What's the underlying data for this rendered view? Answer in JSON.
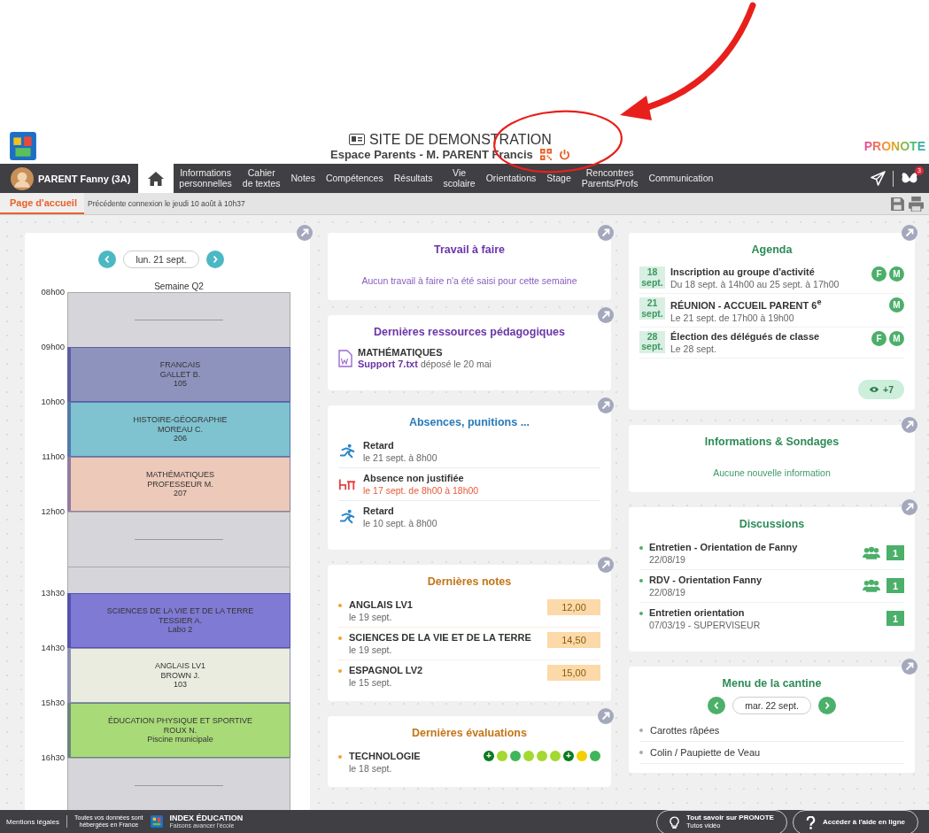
{
  "header": {
    "title": "SITE DE DEMONSTRATION",
    "subtitle": "Espace Parents - M. PARENT Francis",
    "brand": "PRONOTE"
  },
  "nav": {
    "user": "PARENT Fanny (3A)",
    "items": [
      {
        "kind": "home",
        "selected": true
      },
      {
        "kind": "text",
        "label": "Informations\npersonnelles",
        "selected": false
      },
      {
        "kind": "text",
        "label": "Cahier\nde textes",
        "selected": false
      },
      {
        "kind": "text",
        "label": "Notes",
        "selected": false
      },
      {
        "kind": "text",
        "label": "Compétences",
        "selected": false
      },
      {
        "kind": "text",
        "label": "Résultats",
        "selected": false
      },
      {
        "kind": "text",
        "label": "Vie\nscolaire",
        "selected": false
      },
      {
        "kind": "text",
        "label": "Orientations",
        "selected": false
      },
      {
        "kind": "text",
        "label": "Stage",
        "selected": false
      },
      {
        "kind": "text",
        "label": "Rencontres\nParents/Profs",
        "selected": false
      },
      {
        "kind": "text",
        "label": "Communication",
        "selected": false
      }
    ],
    "notification_badge": "3"
  },
  "subbar": {
    "tabs": [
      {
        "label": "Page d'accueil",
        "selected": true
      }
    ],
    "last_login": "Précédente connexion le jeudi 10 août à 10h37"
  },
  "timetable": {
    "date": "lun. 21 sept.",
    "week": "Semaine Q2",
    "slots": [
      {
        "time": "08h00",
        "kind": "free"
      },
      {
        "time": "09h00",
        "kind": "course",
        "color": "#8e93bd",
        "lines": [
          "FRANCAIS",
          "GALLET B.",
          "105"
        ]
      },
      {
        "time": "10h00",
        "kind": "course",
        "color": "#7fc2d0",
        "lines": [
          "HISTOIRE-GÉOGRAPHIE",
          "MOREAU C.",
          "206"
        ]
      },
      {
        "time": "11h00",
        "kind": "course",
        "color": "#ecc9b9",
        "lines": [
          "MATHÉMATIQUES",
          "PROFESSEUR M.",
          "207"
        ]
      },
      {
        "time": "12h00",
        "kind": "free"
      },
      {
        "kind": "break"
      },
      {
        "time": "13h30",
        "kind": "course",
        "color": "#7f7ad3",
        "lines": [
          "SCIENCES DE LA VIE ET DE LA TERRE",
          "TESSIER A.",
          "Labo 2"
        ]
      },
      {
        "time": "14h30",
        "kind": "course",
        "color": "#ebece0",
        "lines": [
          "ANGLAIS LV1",
          "BROWN J.",
          "103"
        ]
      },
      {
        "time": "15h30",
        "kind": "course",
        "color": "#a9da78",
        "lines": [
          "ÉDUCATION PHYSIQUE ET SPORTIVE",
          "ROUX N.",
          "Piscine municipale"
        ]
      },
      {
        "time": "16h30",
        "kind": "free"
      }
    ]
  },
  "homework": {
    "title": "Travail à faire",
    "message": "Aucun travail à faire n'a été saisi pour cette semaine"
  },
  "resources": {
    "title": "Dernières ressources pédagogiques",
    "items": [
      {
        "subject": "MATHÉMATIQUES",
        "file": "Support 7.txt",
        "note": "déposé le 20 mai"
      }
    ]
  },
  "absences": {
    "title": "Absences, punitions ...",
    "items": [
      {
        "kind": "late",
        "title": "Retard",
        "detail": "le 21 sept. à 8h00"
      },
      {
        "kind": "absence",
        "title": "Absence non justifiée",
        "detail": "le 17 sept. de 8h00 à 18h00"
      },
      {
        "kind": "late",
        "title": "Retard",
        "detail": "le 10 sept. à 8h00"
      }
    ]
  },
  "grades": {
    "title": "Dernières notes",
    "items": [
      {
        "subject": "ANGLAIS LV1",
        "date": "le 19 sept.",
        "grade": "12,00"
      },
      {
        "subject": "SCIENCES DE LA VIE ET DE LA TERRE",
        "date": "le 19 sept.",
        "grade": "14,50"
      },
      {
        "subject": "ESPAGNOL LV2",
        "date": "le 15 sept.",
        "grade": "15,00"
      }
    ]
  },
  "evaluations": {
    "title": "Dernières évaluations",
    "items": [
      {
        "subject": "TECHNOLOGIE",
        "date": "le 18 sept.",
        "dots": [
          {
            "color": "#0b7a1c",
            "label": "+"
          },
          {
            "color": "#a3d930"
          },
          {
            "color": "#3fb65a"
          },
          {
            "color": "#a3d930"
          },
          {
            "color": "#a3d930"
          },
          {
            "color": "#a3d930"
          },
          {
            "color": "#0b7a1c",
            "label": "+"
          },
          {
            "color": "#f2d000"
          },
          {
            "color": "#3fb65a"
          }
        ]
      }
    ]
  },
  "agenda": {
    "title": "Agenda",
    "items": [
      {
        "day": "18",
        "month": "sept.",
        "title": "Inscription au groupe d'activité",
        "detail": "Du 18 sept. à 14h00 au 25 sept. à 17h00",
        "badges": [
          "F",
          "M"
        ]
      },
      {
        "day": "21",
        "month": "sept.",
        "title": "RÉUNION - ACCUEIL PARENT 6$^{e}$",
        "detail": "Le 21 sept. de 17h00 à 19h00",
        "badges": [
          "M"
        ]
      },
      {
        "day": "28",
        "month": "sept.",
        "title": "Élection des délégués de classe",
        "detail": "Le 28 sept.",
        "badges": [
          "F",
          "M"
        ]
      }
    ],
    "more": "+7"
  },
  "info": {
    "title": "Informations & Sondages",
    "message": "Aucune nouvelle information"
  },
  "discussions": {
    "title": "Discussions",
    "items": [
      {
        "title": "Entretien - Orientation de Fanny",
        "detail": "22/08/19",
        "group": true,
        "count": "1"
      },
      {
        "title": "RDV - Orientation Fanny",
        "detail": "22/08/19",
        "group": true,
        "count": "1"
      },
      {
        "title": "Entretien orientation",
        "detail": "07/03/19  - SUPERVISEUR",
        "group": false,
        "count": "1"
      }
    ]
  },
  "canteen": {
    "title": "Menu de la cantine",
    "date": "mar. 22 sept.",
    "items": [
      "Carottes râpées",
      "Colin / Paupiette de Veau"
    ]
  },
  "footer": {
    "legal": "Mentions légales",
    "hosting": "Toutes vos données sont\nhébergées en France",
    "company": "INDEX ÉDUCATION",
    "slogan": "Faisons avancer l'école",
    "help_buttons": [
      {
        "kind": "tips",
        "title": "Tout savoir sur PRONOTE",
        "subtitle": "Tutos vidéo"
      },
      {
        "kind": "help",
        "title": "Accéder à l'aide en ligne"
      }
    ]
  }
}
